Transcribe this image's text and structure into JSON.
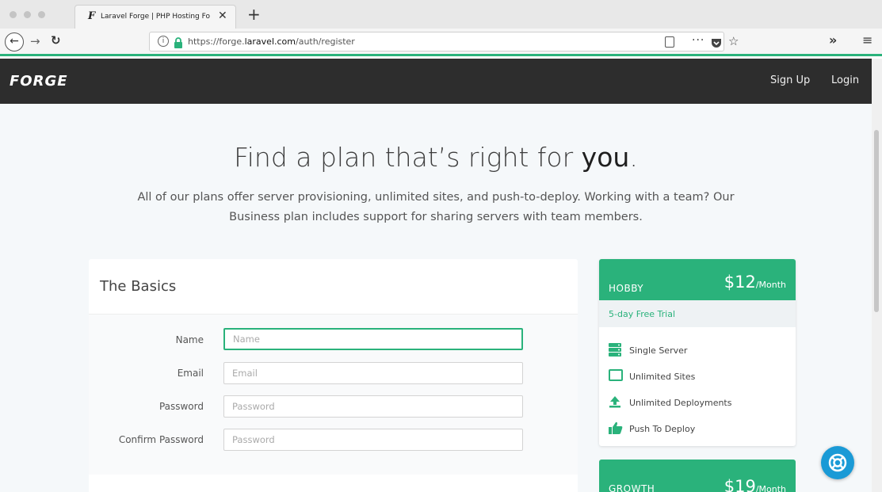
{
  "browser": {
    "tab_title": "Laravel Forge | PHP Hosting Fo",
    "tab_favicon": "F",
    "url_prefix": "https://forge.",
    "url_domain": "laravel.com",
    "url_path": "/auth/register"
  },
  "header": {
    "logo": "FORGE",
    "signup_label": "Sign Up",
    "login_label": "Login"
  },
  "hero": {
    "headline_main": "Find a plan that’s right for ",
    "headline_bold": "you",
    "headline_end": ".",
    "subtext": "All of our plans offer server provisioning, unlimited sites, and push-to-deploy. Working with a team? Our Business plan includes support for sharing servers with team members."
  },
  "basics": {
    "title": "The Basics",
    "fields": [
      {
        "label": "Name",
        "placeholder": "Name"
      },
      {
        "label": "Email",
        "placeholder": "Email"
      },
      {
        "label": "Password",
        "placeholder": "Password"
      },
      {
        "label": "Confirm Password",
        "placeholder": "Password"
      }
    ]
  },
  "plans": [
    {
      "name": "HOBBY",
      "price": "$12",
      "period": "/Month",
      "trial": "5-day Free Trial",
      "features": [
        {
          "icon": "server-icon",
          "label": "Single Server"
        },
        {
          "icon": "window-icon",
          "label": "Unlimited Sites"
        },
        {
          "icon": "upload-icon",
          "label": "Unlimited Deployments"
        },
        {
          "icon": "thumbs-up-icon",
          "label": "Push To Deploy"
        }
      ]
    },
    {
      "name": "GROWTH",
      "price": "$19",
      "period": "/Month"
    }
  ],
  "colors": {
    "accent": "#2ab27b",
    "header_bg": "#2d2d2d",
    "help_button": "#1a9ad6"
  }
}
